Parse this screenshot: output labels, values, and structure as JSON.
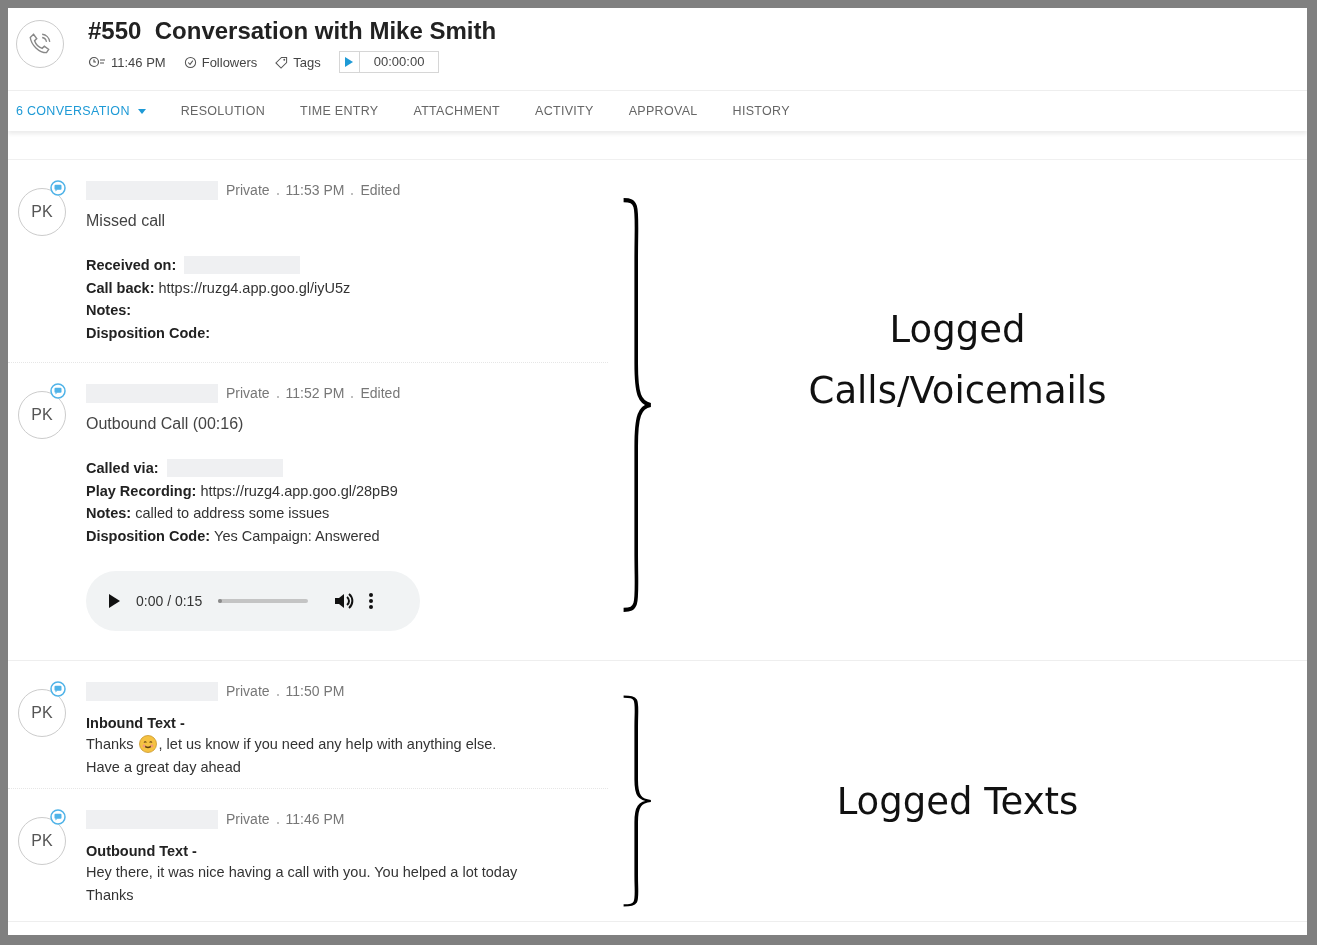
{
  "ticket": {
    "number": "#550",
    "title": "Conversation with Mike Smith",
    "time": "11:46 PM",
    "followers": "Followers",
    "tags": "Tags",
    "timer": "00:00:00"
  },
  "tabs": [
    {
      "label": "6 CONVERSATION",
      "selected": true,
      "dropdown": true
    },
    {
      "label": "RESOLUTION",
      "selected": false
    },
    {
      "label": "TIME ENTRY",
      "selected": false
    },
    {
      "label": "ATTACHMENT",
      "selected": false
    },
    {
      "label": "ACTIVITY",
      "selected": false
    },
    {
      "label": "APPROVAL",
      "selected": false
    },
    {
      "label": "HISTORY",
      "selected": false
    }
  ],
  "groups": [
    {
      "annotation": [
        "Logged",
        "Calls/Voicemails"
      ],
      "messages": [
        {
          "kind": "call",
          "initials": "PK",
          "visibility": "Private",
          "time": "11:53 PM",
          "status": "Edited",
          "heading": "Missed call",
          "fields": [
            {
              "label": "Received on:",
              "redacted": true
            },
            {
              "label": "Call back:",
              "value": "https://ruzg4.app.goo.gl/iyU5z"
            },
            {
              "label": "Notes:"
            },
            {
              "label": "Disposition Code:"
            }
          ]
        },
        {
          "kind": "call",
          "initials": "PK",
          "visibility": "Private",
          "time": "11:52 PM",
          "status": "Edited",
          "heading": "Outbound Call (00:16)",
          "fields": [
            {
              "label": "Called via:",
              "redacted": true
            },
            {
              "label": "Play Recording:",
              "value": "https://ruzg4.app.goo.gl/28pB9"
            },
            {
              "label": "Notes:",
              "value": "called to address some issues"
            },
            {
              "label": "Disposition Code:",
              "value": "Yes Campaign: Answered"
            }
          ],
          "audio": {
            "time": "0:00 / 0:15",
            "level": 0
          }
        }
      ]
    },
    {
      "annotation": [
        "Logged Texts"
      ],
      "messages": [
        {
          "kind": "text",
          "initials": "PK",
          "visibility": "Private",
          "time": "11:50 PM",
          "heading": "Inbound Text -",
          "lines": [
            [
              {
                "text": "Thanks"
              },
              {
                "kind": "emoji"
              },
              {
                "text": ", let us know if you need any help with anything else."
              }
            ],
            [
              {
                "text": "Have a great day ahead"
              }
            ]
          ]
        },
        {
          "kind": "text",
          "initials": "PK",
          "visibility": "Private",
          "time": "11:46 PM",
          "heading": "Outbound Text -",
          "lines": [
            [
              {
                "text": "Hey there, it was nice having a call with you. You helped a lot today"
              }
            ],
            [
              {
                "text": "Thanks"
              }
            ]
          ]
        }
      ]
    }
  ]
}
